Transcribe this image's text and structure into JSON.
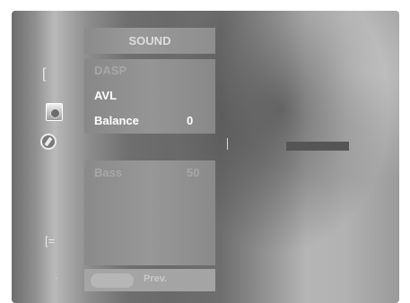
{
  "menu": {
    "title": "SOUND",
    "items": [
      {
        "label": "DASP",
        "value": ""
      },
      {
        "label": "AVL",
        "value": ""
      },
      {
        "label": "Balance",
        "value": "0"
      }
    ],
    "lower_items": [
      {
        "label": "Bass",
        "value": "50"
      }
    ],
    "footer": {
      "prev_label": "Prev."
    }
  },
  "sidebar": {
    "icons": [
      "bracket-icon",
      "speaker-icon",
      "dial-icon",
      "subtitle-icon",
      "dot-icon"
    ]
  },
  "balance_level": 0,
  "colors": {
    "menu_bg": "#909090",
    "highlight_text": "#ffffff",
    "dim_text": "#a7a7a7",
    "bar": "#555555"
  }
}
